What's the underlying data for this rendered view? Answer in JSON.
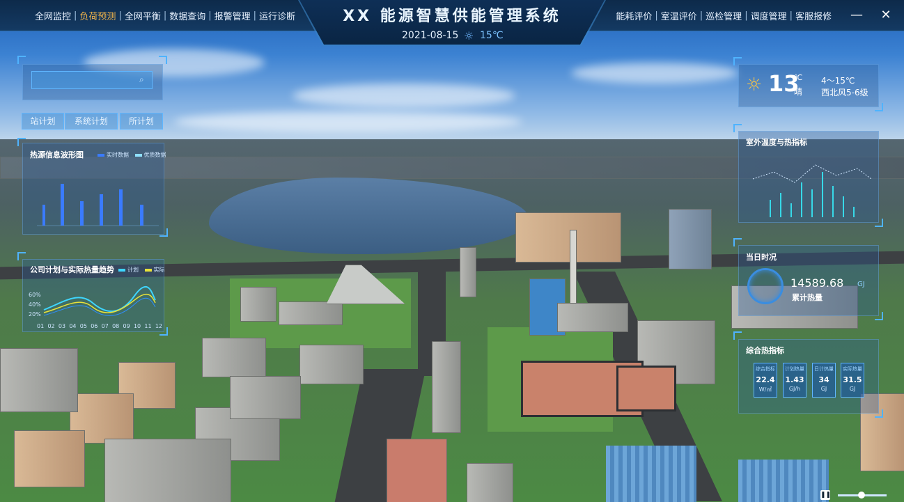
{
  "app": {
    "title": "XX 能源智慧供能管理系统",
    "date": "2021-08-15",
    "weather_top": {
      "icon": "sun-icon",
      "temp": "15℃"
    }
  },
  "nav_left": [
    {
      "label": "全网监控",
      "active": false
    },
    {
      "label": "负荷预测",
      "active": true
    },
    {
      "label": "全网平衡",
      "active": false
    },
    {
      "label": "数据查询",
      "active": false
    },
    {
      "label": "报警管理",
      "active": false
    },
    {
      "label": "运行诊断",
      "active": false
    }
  ],
  "nav_right": [
    {
      "label": "能耗评价"
    },
    {
      "label": "室温评价"
    },
    {
      "label": "巡检管理"
    },
    {
      "label": "调度管理"
    },
    {
      "label": "客服报修"
    }
  ],
  "window_controls": {
    "minimize": "—",
    "close": "✕"
  },
  "left_panel": {
    "search_value": "",
    "plan_buttons": [
      "站计划",
      "系统计划",
      "所计划"
    ],
    "heat_chart": {
      "title": "热源信息波形图",
      "legend": [
        "实时数据",
        "优质数据"
      ]
    },
    "trend_chart": {
      "title": "公司计划与实际热量趋势",
      "legend": [
        "计划",
        "实际"
      ],
      "y_ticks": [
        "60%",
        "40%",
        "20%"
      ],
      "x_ticks": [
        "01",
        "02",
        "03",
        "04",
        "05",
        "06",
        "07",
        "08",
        "09",
        "10",
        "11",
        "12"
      ]
    }
  },
  "weather_panel": {
    "temp": "13",
    "unit": "℃",
    "condition": "晴",
    "range": "4～15℃",
    "wind": "西北风5-6级"
  },
  "outdoor_panel": {
    "title": "室外温度与热指标"
  },
  "daily_panel": {
    "title": "当日时况",
    "value": "14589.68",
    "unit": "GJ",
    "label": "累计热量"
  },
  "kpi_panel": {
    "title": "综合热指标",
    "items": [
      {
        "label": "综合指标",
        "value": "22.4",
        "unit": "W/㎡"
      },
      {
        "label": "计划热量",
        "value": "1.43",
        "unit": "GJ/h"
      },
      {
        "label": "日计热量",
        "value": "34",
        "unit": "GJ"
      },
      {
        "label": "实际热量",
        "value": "31.5",
        "unit": "GJ"
      }
    ]
  },
  "colors": {
    "accent": "#4fb3ff",
    "active_nav": "#f3b54a",
    "panel_border": "#5fb6ff"
  }
}
